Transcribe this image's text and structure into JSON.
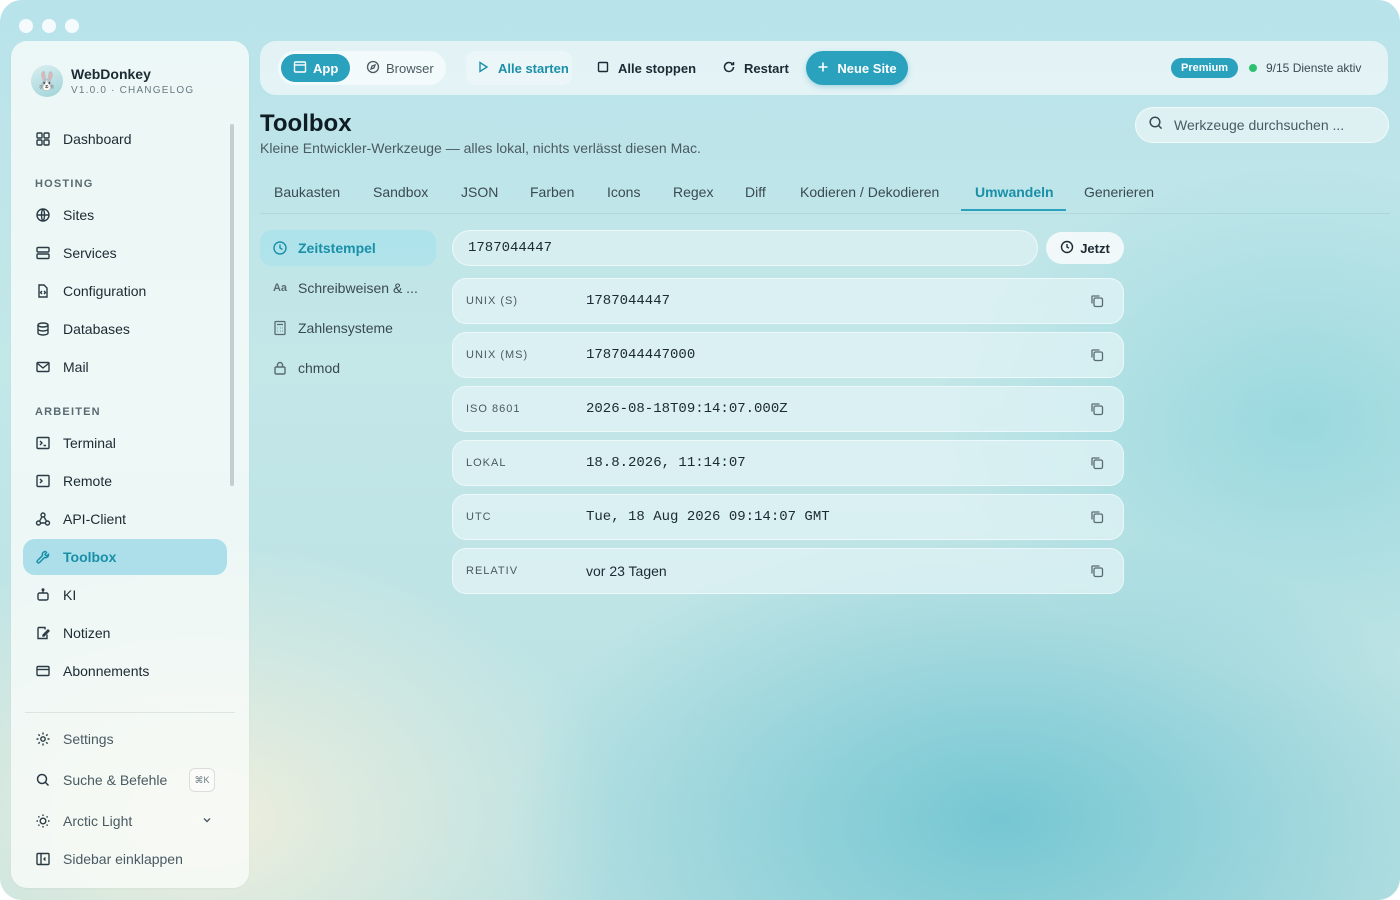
{
  "brand": {
    "name": "WebDonkey",
    "version": "V1.0.0 · CHANGELOG"
  },
  "sidebar": {
    "dashboard": "Dashboard",
    "hosting_label": "HOSTING",
    "hosting": [
      "Sites",
      "Services",
      "Configuration",
      "Databases",
      "Mail"
    ],
    "arbeiten_label": "ARBEITEN",
    "arbeiten": [
      "Terminal",
      "Remote",
      "API-Client",
      "Toolbox",
      "KI",
      "Notizen",
      "Abonnements"
    ],
    "active_item": "Toolbox",
    "settings": "Settings",
    "search": "Suche & Befehle",
    "search_shortcut": "⌘K",
    "theme": "Arctic Light",
    "collapse": "Sidebar einklappen"
  },
  "toolbar": {
    "mode_app": "App",
    "mode_browser": "Browser",
    "start_all": "Alle starten",
    "stop_all": "Alle stoppen",
    "restart": "Restart",
    "new_site": "Neue Site",
    "premium": "Premium",
    "services_status": "9/15 Dienste aktiv"
  },
  "colors": {
    "accent": "#2aa1bd",
    "status_ok": "#2fbf71"
  },
  "header": {
    "title": "Toolbox",
    "subtitle": "Kleine Entwickler-Werkzeuge — alles lokal, nichts verlässt diesen Mac.",
    "search_placeholder": "Werkzeuge durchsuchen ..."
  },
  "tabs": [
    "Baukasten",
    "Sandbox",
    "JSON",
    "Farben",
    "Icons",
    "Regex",
    "Diff",
    "Kodieren / Dekodieren",
    "Umwandeln",
    "Generieren"
  ],
  "active_tab": "Umwandeln",
  "subnav": [
    "Zeitstempel",
    "Schreibweisen & ...",
    "Zahlensysteme",
    "chmod"
  ],
  "active_subnav": "Zeitstempel",
  "converter": {
    "input_value": "1787044447",
    "now_button": "Jetzt",
    "rows": [
      {
        "label": "UNIX (S)",
        "value": "1787044447"
      },
      {
        "label": "UNIX (MS)",
        "value": "1787044447000"
      },
      {
        "label": "ISO 8601",
        "value": "2026-08-18T09:14:07.000Z"
      },
      {
        "label": "LOKAL",
        "value": "18.8.2026, 11:14:07"
      },
      {
        "label": "UTC",
        "value": "Tue, 18 Aug 2026 09:14:07 GMT"
      },
      {
        "label": "RELATIV",
        "value": "vor 23 Tagen"
      }
    ]
  }
}
